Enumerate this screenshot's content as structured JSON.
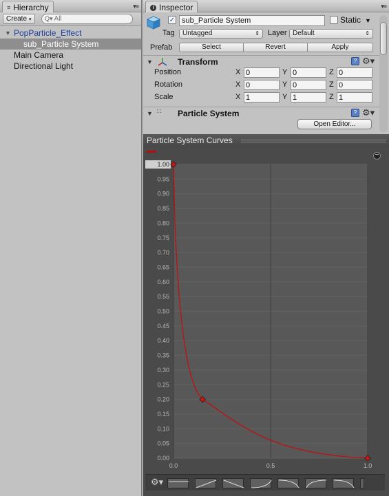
{
  "hierarchy": {
    "tab_label": "Hierarchy",
    "create_label": "Create",
    "search_placeholder": "All",
    "items": [
      {
        "label": "PopParticle_Effect"
      },
      {
        "label": "sub_Particle System"
      },
      {
        "label": "Main Camera"
      },
      {
        "label": "Directional Light"
      }
    ]
  },
  "inspector": {
    "tab_label": "Inspector",
    "object_name": "sub_Particle System",
    "static_label": "Static",
    "tag_label": "Tag",
    "tag_value": "Untagged",
    "layer_label": "Layer",
    "layer_value": "Default",
    "prefab_label": "Prefab",
    "prefab_buttons": [
      "Select",
      "Revert",
      "Apply"
    ],
    "transform": {
      "title": "Transform",
      "rows": [
        {
          "name": "Position",
          "x": "0",
          "y": "0",
          "z": "0"
        },
        {
          "name": "Rotation",
          "x": "0",
          "y": "0",
          "z": "0"
        },
        {
          "name": "Scale",
          "x": "1",
          "y": "1",
          "z": "1"
        }
      ],
      "axis_labels": [
        "X",
        "Y",
        "Z"
      ]
    },
    "particle_system": {
      "title": "Particle System",
      "open_editor_label": "Open Editor..."
    }
  },
  "curves_panel": {
    "title": "Particle System Curves",
    "curve_color": "#c01010"
  },
  "chart_data": {
    "type": "line",
    "ylim": [
      0,
      1
    ],
    "xlim": [
      0,
      1
    ],
    "y_ticks": [
      "1.00",
      "0.95",
      "0.90",
      "0.85",
      "0.80",
      "0.75",
      "0.70",
      "0.65",
      "0.60",
      "0.55",
      "0.50",
      "0.45",
      "0.40",
      "0.35",
      "0.30",
      "0.25",
      "0.20",
      "0.15",
      "0.10",
      "0.05",
      "0.00"
    ],
    "x_ticks": [
      "0.0",
      "0.5",
      "1.0"
    ],
    "keys": [
      {
        "x": 0.0,
        "y": 1.0
      },
      {
        "x": 0.15,
        "y": 0.2
      },
      {
        "x": 1.0,
        "y": 0.0
      }
    ],
    "series_color": "#c01010"
  }
}
